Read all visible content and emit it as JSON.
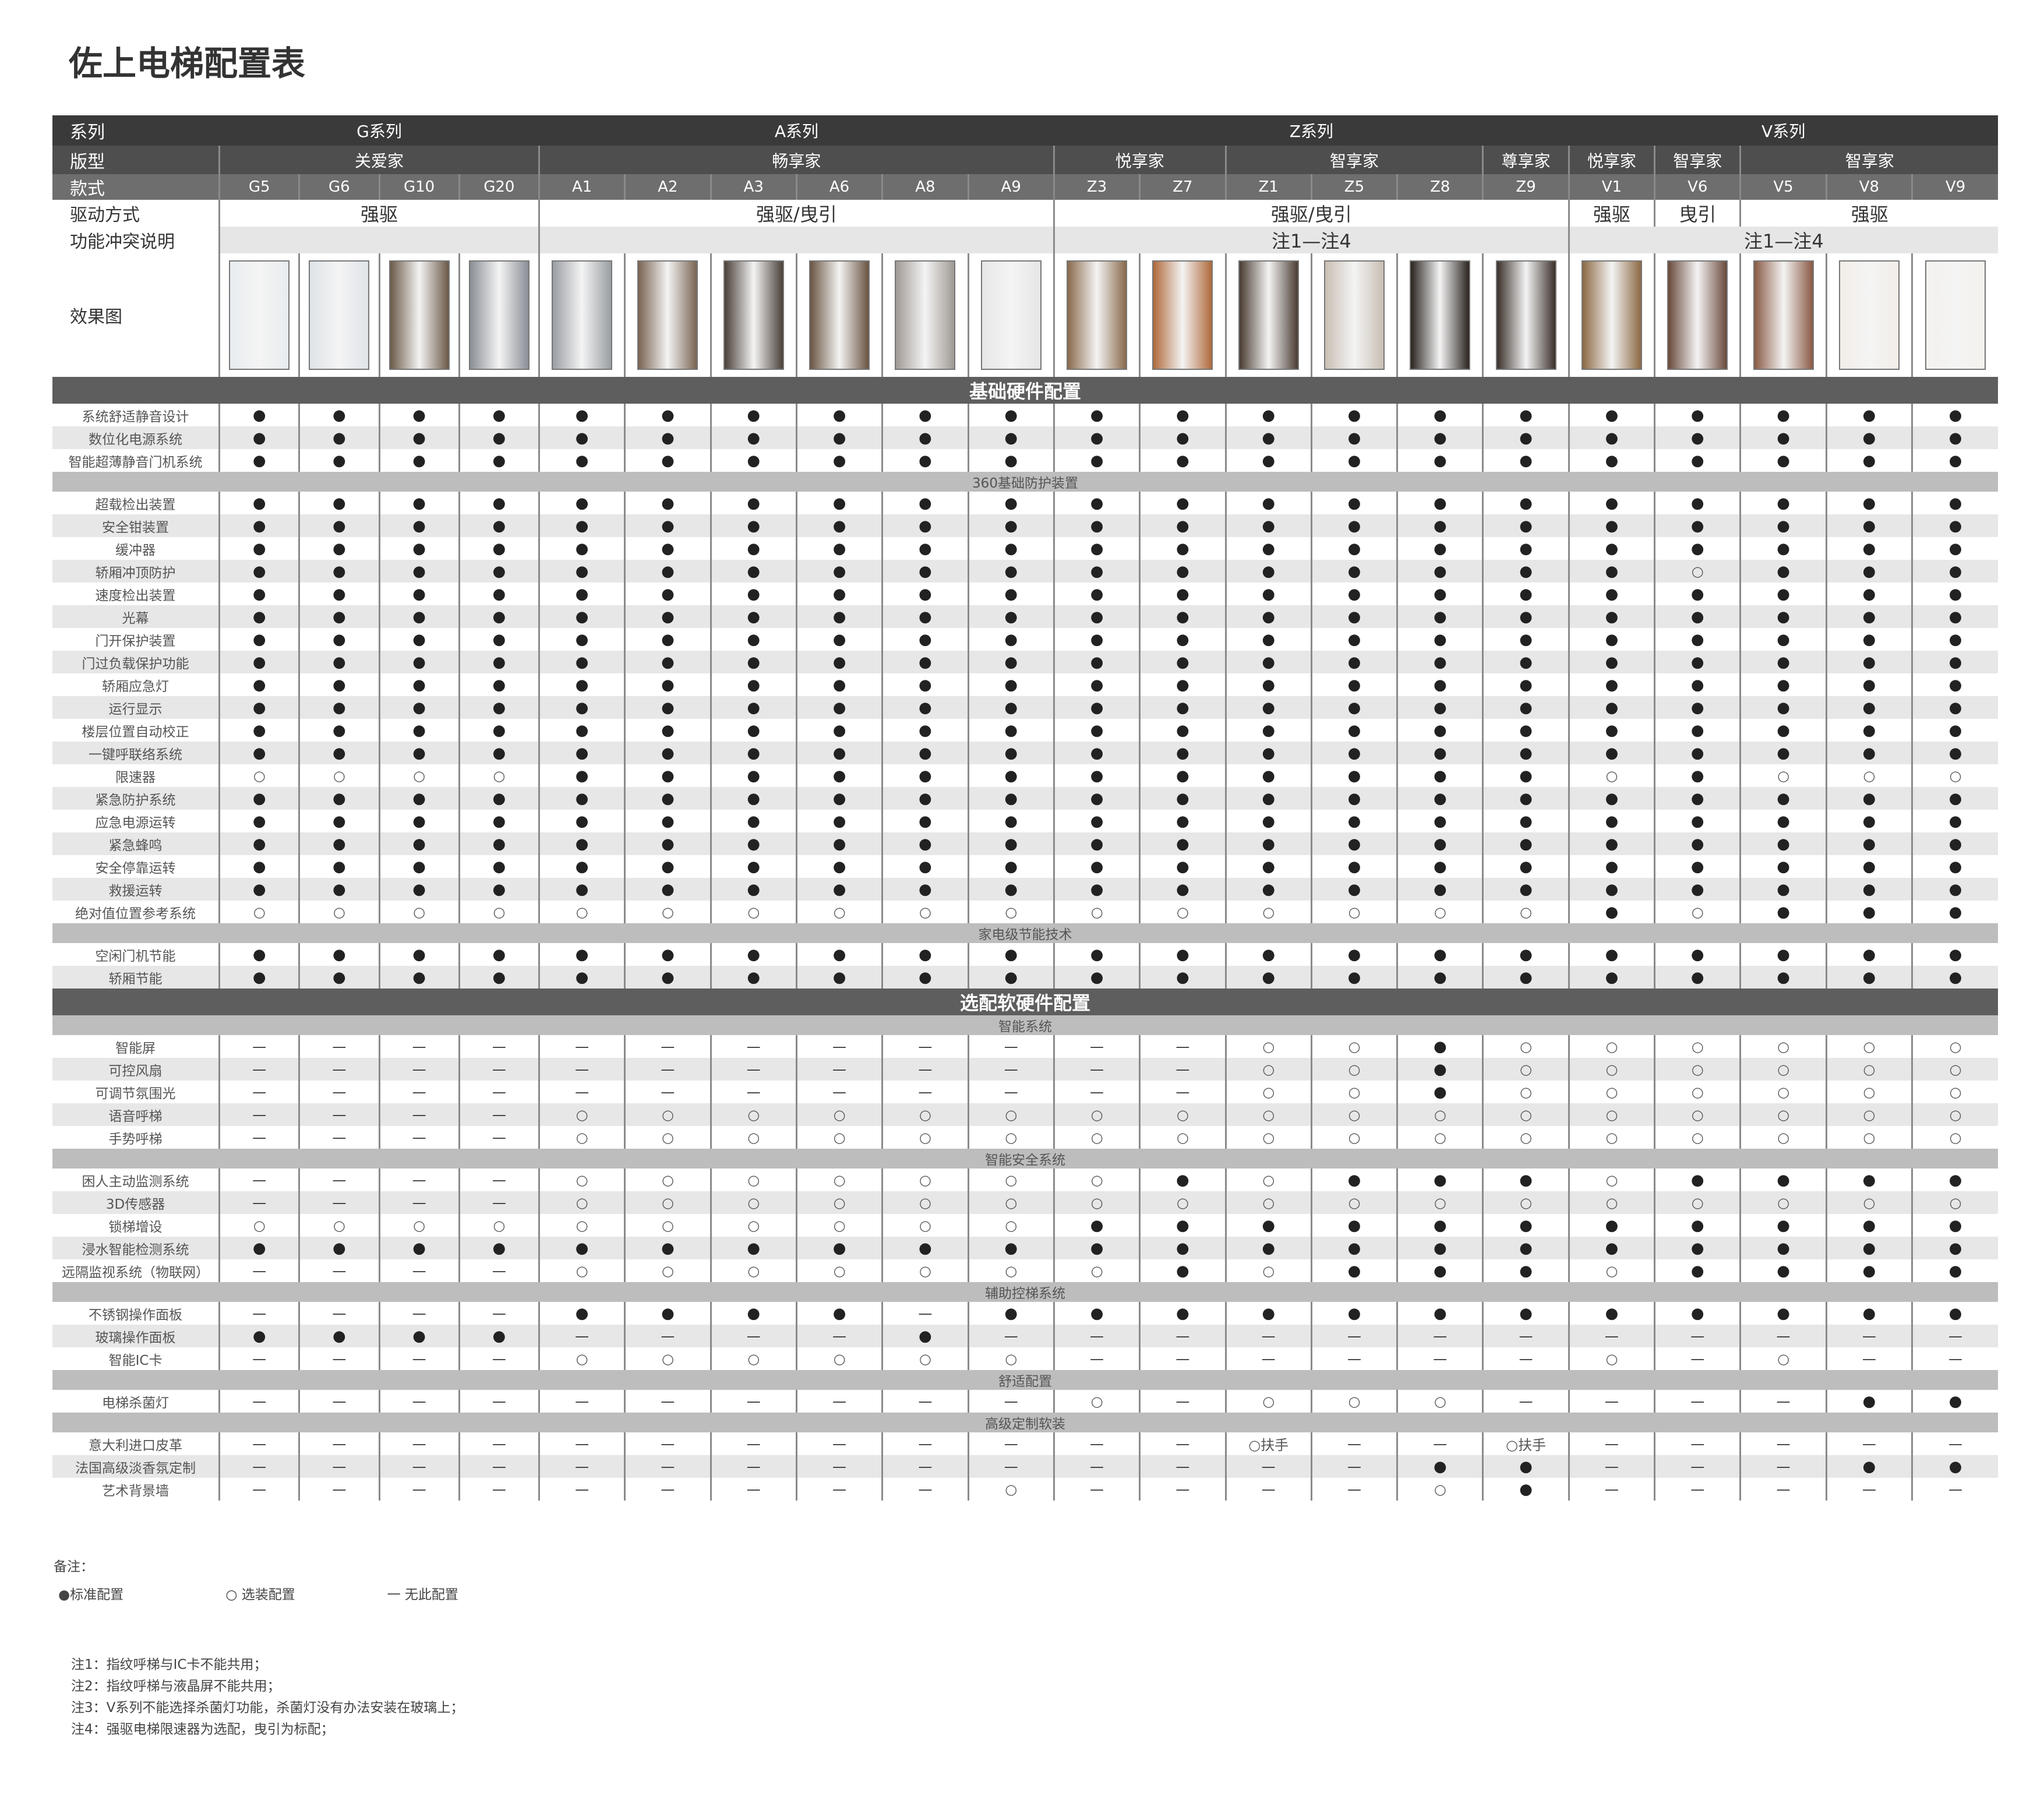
{
  "title": "佐上电梯配置表",
  "header": {
    "series_label": "系列",
    "type_label": "版型",
    "model_label": "款式",
    "drive_label": "驱动方式",
    "conflict_label": "功能冲突说明",
    "image_label": "效果图",
    "series": [
      {
        "name": "G系列",
        "span": 4
      },
      {
        "name": "A系列",
        "span": 6
      },
      {
        "name": "Z系列",
        "span": 6
      },
      {
        "name": "V系列",
        "span": 5
      }
    ],
    "types": [
      {
        "name": "关爱家",
        "span": 4
      },
      {
        "name": "畅享家",
        "span": 6
      },
      {
        "name": "悦享家",
        "span": 2
      },
      {
        "name": "智享家",
        "span": 3
      },
      {
        "name": "尊享家",
        "span": 1
      },
      {
        "name": "悦享家",
        "span": 1
      },
      {
        "name": "智享家",
        "span": 1
      },
      {
        "name": "智享家",
        "span": 3
      }
    ],
    "models": [
      "G5",
      "G6",
      "G10",
      "G20",
      "A1",
      "A2",
      "A3",
      "A6",
      "A8",
      "A9",
      "Z3",
      "Z7",
      "Z1",
      "Z5",
      "Z8",
      "Z9",
      "V1",
      "V6",
      "V5",
      "V8",
      "V9"
    ],
    "drive": [
      {
        "text": "强驱",
        "span": 4
      },
      {
        "text": "强驱/曳引",
        "span": 6
      },
      {
        "text": "强驱/曳引",
        "span": 6
      },
      {
        "text": "强驱",
        "span": 1
      },
      {
        "text": "曳引",
        "span": 1
      },
      {
        "text": "强驱",
        "span": 3
      }
    ],
    "conflict": [
      {
        "text": "",
        "span": 4
      },
      {
        "text": "",
        "span": 6
      },
      {
        "text": "注1—注4",
        "span": 6
      },
      {
        "text": "注1—注4",
        "span": 5
      }
    ]
  },
  "car_colors": [
    "#e8ecef",
    "#dfe4e8",
    "#6b5a48",
    "#8a8f96",
    "#9a9ea3",
    "#7a6452",
    "#4a4038",
    "#6a5442",
    "#a09a94",
    "#e6e6e6",
    "#8a6a4c",
    "#b06a3c",
    "#4a3c32",
    "#c9bfb4",
    "#2a2420",
    "#3a302a",
    "#8c6a44",
    "#6a4a3c",
    "#8a5a44",
    "#f2ede8",
    "#f4f1ee"
  ],
  "sections": [
    {
      "kind": "section",
      "label": "基础硬件配置"
    },
    {
      "kind": "item",
      "label": "系统舒适静音设计",
      "values": "SSSSSSSSSSSSSSSSSSSSS"
    },
    {
      "kind": "item",
      "label": "数位化电源系统",
      "values": "SSSSSSSSSSSSSSSSSSSSS"
    },
    {
      "kind": "item",
      "label": "智能超薄静音门机系统",
      "values": "SSSSSSSSSSSSSSSSSSSSS"
    },
    {
      "kind": "sub",
      "label": "360基础防护装置"
    },
    {
      "kind": "item",
      "label": "超载检出装置",
      "values": "SSSSSSSSSSSSSSSSSSSSS"
    },
    {
      "kind": "item",
      "label": "安全钳装置",
      "values": "SSSSSSSSSSSSSSSSSSSSS"
    },
    {
      "kind": "item",
      "label": "缓冲器",
      "values": "SSSSSSSSSSSSSSSSSSSSS"
    },
    {
      "kind": "item",
      "label": "轿厢冲顶防护",
      "values": "SSSSSSSSSSSSSSSSSOSSS"
    },
    {
      "kind": "item",
      "label": "速度检出装置",
      "values": "SSSSSSSSSSSSSSSSSSSSS"
    },
    {
      "kind": "item",
      "label": "光幕",
      "values": "SSSSSSSSSSSSSSSSSSSSS"
    },
    {
      "kind": "item",
      "label": "门开保护装置",
      "values": "SSSSSSSSSSSSSSSSSSSSS"
    },
    {
      "kind": "item",
      "label": "门过负载保护功能",
      "values": "SSSSSSSSSSSSSSSSSSSSS"
    },
    {
      "kind": "item",
      "label": "轿厢应急灯",
      "values": "SSSSSSSSSSSSSSSSSSSSS"
    },
    {
      "kind": "item",
      "label": "运行显示",
      "values": "SSSSSSSSSSSSSSSSSSSSS"
    },
    {
      "kind": "item",
      "label": "楼层位置自动校正",
      "values": "SSSSSSSSSSSSSSSSSSSSS"
    },
    {
      "kind": "item",
      "label": "一键呼联络系统",
      "values": "SSSSSSSSSSSSSSSSSSSSS"
    },
    {
      "kind": "item",
      "label": "限速器",
      "values": "OOOOSSSSSSSSSSSSOSOOO"
    },
    {
      "kind": "item",
      "label": "紧急防护系统",
      "values": "SSSSSSSSSSSSSSSSSSSSS"
    },
    {
      "kind": "item",
      "label": "应急电源运转",
      "values": "SSSSSSSSSSSSSSSSSSSSS"
    },
    {
      "kind": "item",
      "label": "紧急蜂鸣",
      "values": "SSSSSSSSSSSSSSSSSSSSS"
    },
    {
      "kind": "item",
      "label": "安全停靠运转",
      "values": "SSSSSSSSSSSSSSSSSSSSS"
    },
    {
      "kind": "item",
      "label": "救援运转",
      "values": "SSSSSSSSSSSSSSSSSSSSS"
    },
    {
      "kind": "item",
      "label": "绝对值位置参考系统",
      "values": "OOOOOOOOOOOOOOOOSOSSS"
    },
    {
      "kind": "sub",
      "label": "家电级节能技术"
    },
    {
      "kind": "item",
      "label": "空闲门机节能",
      "values": "SSSSSSSSSSSSSSSSSSSSS"
    },
    {
      "kind": "item",
      "label": "轿厢节能",
      "values": "SSSSSSSSSSSSSSSSSSSSS"
    },
    {
      "kind": "section",
      "label": "选配软硬件配置"
    },
    {
      "kind": "sub",
      "label": "智能系统"
    },
    {
      "kind": "item",
      "label": "智能屏",
      "values": "------------OOSOOOOOO"
    },
    {
      "kind": "item",
      "label": "可控风扇",
      "values": "------------OOSOOOOOO"
    },
    {
      "kind": "item",
      "label": "可调节氛围光",
      "values": "------------OOSOOOOOO"
    },
    {
      "kind": "item",
      "label": "语音呼梯",
      "values": "----OOOOOOOOOOOOOOOOO"
    },
    {
      "kind": "item",
      "label": "手势呼梯",
      "values": "----OOOOOOOOOOOOOOOOO"
    },
    {
      "kind": "sub",
      "label": "智能安全系统"
    },
    {
      "kind": "item",
      "label": "困人主动监测系统",
      "values": "----OOOOOOOSOSSSOSSSS"
    },
    {
      "kind": "item",
      "label": "3D传感器",
      "values": "----OOOOOOOOOOOOOOOOO"
    },
    {
      "kind": "item",
      "label": "锁梯增设",
      "values": "OOOOOOOOOOSSSSSSSSSSS"
    },
    {
      "kind": "item",
      "label": "浸水智能检测系统",
      "values": "SSSSSSSSSSSSSSSSSSSSS"
    },
    {
      "kind": "item",
      "label": "远隔监视系统（物联网）",
      "values": "----OOOOOOOSOSSSOSSSS"
    },
    {
      "kind": "sub",
      "label": "辅助控梯系统"
    },
    {
      "kind": "item",
      "label": "不锈钢操作面板",
      "values": "----SSSS-SSSSSSSSSSSS"
    },
    {
      "kind": "item",
      "label": "玻璃操作面板",
      "values": "SSSS----S------------"
    },
    {
      "kind": "item",
      "label": "智能IC卡",
      "values": "----OOOOOO------O-O--"
    },
    {
      "kind": "sub",
      "label": "舒适配置"
    },
    {
      "kind": "item",
      "label": "电梯杀菌灯",
      "values": "----------O-OOO----SS"
    },
    {
      "kind": "sub",
      "label": "高级定制软装"
    },
    {
      "kind": "item",
      "label": "意大利进口皮革",
      "values": "------------H--H-----"
    },
    {
      "kind": "item",
      "label": "法国高级淡香氛定制",
      "values": "--------------SS---SS"
    },
    {
      "kind": "item",
      "label": "艺术背景墙",
      "values": "---------O----OS-----"
    }
  ],
  "symbols": {
    "S": "●",
    "O": "○",
    "-": "—",
    "H": "○扶手"
  },
  "legend": {
    "title": "备注：",
    "standard": "●标准配置",
    "optional": "○ 选装配置",
    "none": "一 无此配置"
  },
  "footnotes": [
    "注1：指纹呼梯与IC卡不能共用；",
    "注2：指纹呼梯与液晶屏不能共用；",
    "注3：V系列不能选择杀菌灯功能，杀菌灯没有办法安装在玻璃上；",
    "注4：强驱电梯限速器为选配，曳引为标配；"
  ]
}
